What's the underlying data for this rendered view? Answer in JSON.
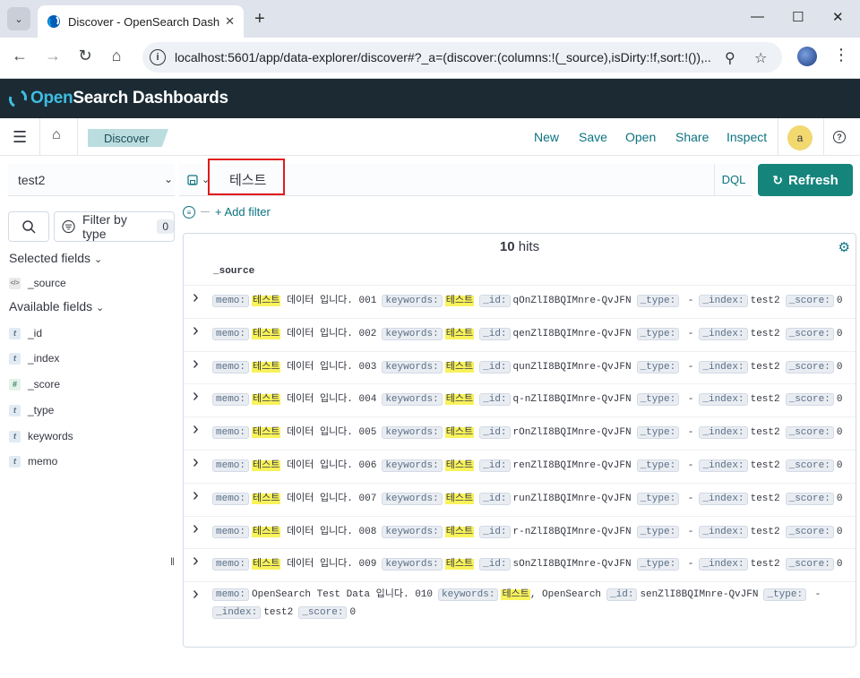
{
  "browser": {
    "tab_title": "Discover - OpenSearch Dashbo",
    "url": "localhost:5601/app/data-explorer/discover#?_a=(discover:(columns:!(_source),isDirty:!f,sort:!()),..."
  },
  "header": {
    "brand_open": "Open",
    "brand_rest": "Search Dashboards"
  },
  "appbar": {
    "breadcrumb": "Discover",
    "links": {
      "new": "New",
      "save": "Save",
      "open": "Open",
      "share": "Share",
      "inspect": "Inspect"
    },
    "avatar_initial": "a"
  },
  "sidebar": {
    "index_pattern": "test2",
    "filter_by_type": "Filter by type",
    "filter_count": "0",
    "selected_fields_title": "Selected fields",
    "selected_fields": [
      {
        "name": "_source",
        "type": "source"
      }
    ],
    "available_fields_title": "Available fields",
    "available_fields": [
      {
        "name": "_id",
        "type": "t"
      },
      {
        "name": "_index",
        "type": "t"
      },
      {
        "name": "_score",
        "type": "#"
      },
      {
        "name": "_type",
        "type": "t"
      },
      {
        "name": "keywords",
        "type": "t"
      },
      {
        "name": "memo",
        "type": "t"
      }
    ]
  },
  "query": {
    "value": "테스트",
    "language": "DQL",
    "refresh_label": "Refresh",
    "add_filter": "+ Add filter"
  },
  "results": {
    "hits_count": "10",
    "hits_label": "hits",
    "column": "_source",
    "rows": [
      {
        "memo_hit": "테스트",
        "memo_rest": "데이터 입니다. 001",
        "keywords": "테스트",
        "id": "qOnZlI8BQIMnre-QvJFN",
        "type": "-",
        "index": "test2",
        "score": "0"
      },
      {
        "memo_hit": "테스트",
        "memo_rest": "데이터 입니다. 002",
        "keywords": "테스트",
        "id": "qenZlI8BQIMnre-QvJFN",
        "type": "-",
        "index": "test2",
        "score": "0"
      },
      {
        "memo_hit": "테스트",
        "memo_rest": "데이터 입니다. 003",
        "keywords": "테스트",
        "id": "qunZlI8BQIMnre-QvJFN",
        "type": "-",
        "index": "test2",
        "score": "0"
      },
      {
        "memo_hit": "테스트",
        "memo_rest": "데이터 입니다. 004",
        "keywords": "테스트",
        "id": "q-nZlI8BQIMnre-QvJFN",
        "type": "-",
        "index": "test2",
        "score": "0"
      },
      {
        "memo_hit": "테스트",
        "memo_rest": "데이터 입니다. 005",
        "keywords": "테스트",
        "id": "rOnZlI8BQIMnre-QvJFN",
        "type": "-",
        "index": "test2",
        "score": "0"
      },
      {
        "memo_hit": "테스트",
        "memo_rest": "데이터 입니다. 006",
        "keywords": "테스트",
        "id": "renZlI8BQIMnre-QvJFN",
        "type": "-",
        "index": "test2",
        "score": "0"
      },
      {
        "memo_hit": "테스트",
        "memo_rest": "데이터 입니다. 007",
        "keywords": "테스트",
        "id": "runZlI8BQIMnre-QvJFN",
        "type": "-",
        "index": "test2",
        "score": "0"
      },
      {
        "memo_hit": "테스트",
        "memo_rest": "데이터 입니다. 008",
        "keywords": "테스트",
        "id": "r-nZlI8BQIMnre-QvJFN",
        "type": "-",
        "index": "test2",
        "score": "0"
      },
      {
        "memo_hit": "테스트",
        "memo_rest": "데이터 입니다. 009",
        "keywords": "테스트",
        "id": "sOnZlI8BQIMnre-QvJFN",
        "type": "-",
        "index": "test2",
        "score": "0"
      }
    ],
    "last_row": {
      "memo": "OpenSearch Test Data 입니다. 010",
      "keywords_hit": "테스트",
      "keywords_rest": ", OpenSearch",
      "id": "senZlI8BQIMnre-QvJFN",
      "type": "-",
      "index": "test2",
      "score": "0"
    },
    "labels": {
      "memo": "memo:",
      "keywords": "keywords:",
      "id": "_id:",
      "type": "_type:",
      "index": "_index:",
      "score": "_score:"
    }
  },
  "colors": {
    "header_bg": "#1b2a33",
    "accent": "#0d7281",
    "refresh_bg": "#15857c",
    "highlight": "#f8f25b",
    "annotation_box": "#e01b1b"
  }
}
